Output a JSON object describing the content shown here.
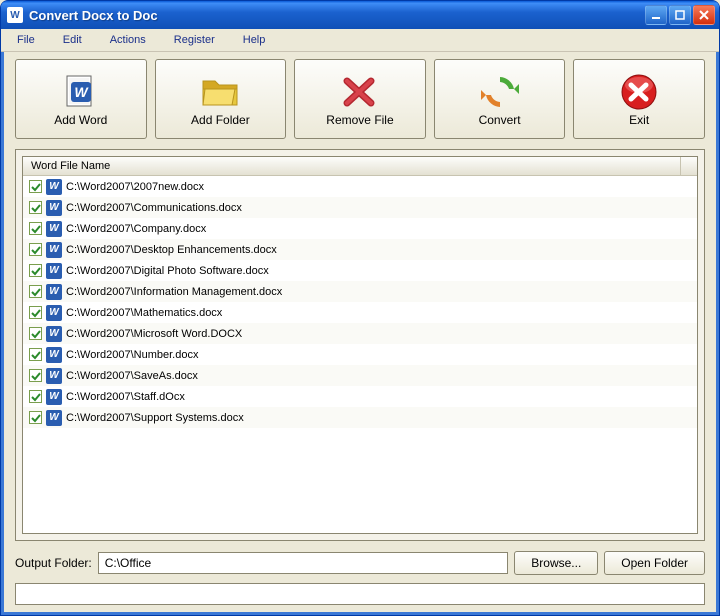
{
  "window": {
    "title": "Convert Docx to Doc"
  },
  "menu": {
    "file": "File",
    "edit": "Edit",
    "actions": "Actions",
    "register": "Register",
    "help": "Help"
  },
  "toolbar": {
    "add_word": "Add Word",
    "add_folder": "Add Folder",
    "remove_file": "Remove File",
    "convert": "Convert",
    "exit": "Exit"
  },
  "list": {
    "header": "Word File Name",
    "items": [
      {
        "checked": true,
        "path": "C:\\Word2007\\2007new.docx"
      },
      {
        "checked": true,
        "path": "C:\\Word2007\\Communications.docx"
      },
      {
        "checked": true,
        "path": "C:\\Word2007\\Company.docx"
      },
      {
        "checked": true,
        "path": "C:\\Word2007\\Desktop Enhancements.docx"
      },
      {
        "checked": true,
        "path": "C:\\Word2007\\Digital Photo Software.docx"
      },
      {
        "checked": true,
        "path": "C:\\Word2007\\Information Management.docx"
      },
      {
        "checked": true,
        "path": "C:\\Word2007\\Mathematics.docx"
      },
      {
        "checked": true,
        "path": "C:\\Word2007\\Microsoft Word.DOCX"
      },
      {
        "checked": true,
        "path": "C:\\Word2007\\Number.docx"
      },
      {
        "checked": true,
        "path": "C:\\Word2007\\SaveAs.docx"
      },
      {
        "checked": true,
        "path": "C:\\Word2007\\Staff.dOcx"
      },
      {
        "checked": true,
        "path": "C:\\Word2007\\Support Systems.docx"
      }
    ]
  },
  "output": {
    "label": "Output Folder:",
    "value": "C:\\Office",
    "browse": "Browse...",
    "open": "Open Folder"
  }
}
